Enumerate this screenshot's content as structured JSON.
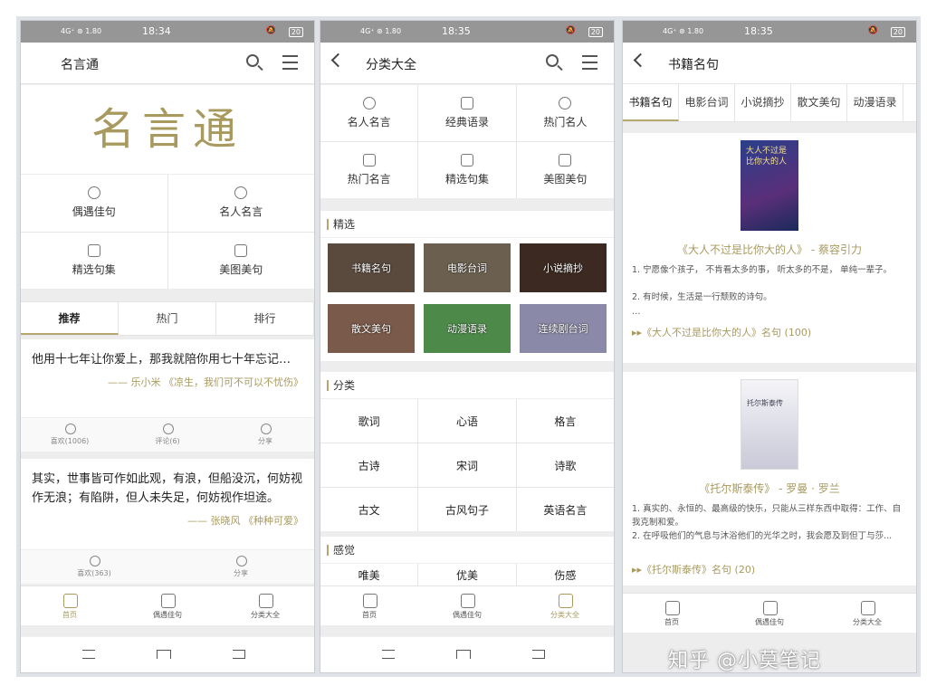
{
  "status": {
    "signal": "4G⁺ ⊛ 1.80",
    "battery": "20",
    "times": [
      "18:34",
      "18:35",
      "18:35"
    ]
  },
  "screen1": {
    "title": "名言通",
    "logo": "名言通",
    "menu": [
      "偶遇佳句",
      "名人名言",
      "精选句集",
      "美图美句"
    ],
    "tabs": [
      "推荐",
      "热门",
      "排行"
    ],
    "posts": [
      {
        "text": "他用十七年让你爱上，那我就陪你用七十年忘记…",
        "author": "—— 乐小米 《凉生，我们可不可以不忧伤》",
        "likes": "喜欢(1006)",
        "comments": "评论(6)",
        "share": "分享"
      },
      {
        "text": "其实，世事皆可作如此观，有浪，但船没沉，何妨视作无浪；有陷阱，但人未失足，何妨视作坦途。",
        "author": "—— 张晓风 《种种可爱》",
        "likes": "喜欢(363)",
        "share": "分享"
      }
    ],
    "nav": [
      "首页",
      "偶遇佳句",
      "分类大全"
    ]
  },
  "screen2": {
    "title": "分类大全",
    "grid": [
      "名人名言",
      "经典语录",
      "热门名人",
      "热门名言",
      "精选句集",
      "美图美句"
    ],
    "featured_label": "精选",
    "featured": [
      "书籍名句",
      "电影台词",
      "小说摘抄",
      "散文美句",
      "动漫语录",
      "连续剧台词"
    ],
    "category_label": "分类",
    "categories": [
      "歌词",
      "心语",
      "格言",
      "古诗",
      "宋词",
      "诗歌",
      "古文",
      "古风句子",
      "英语名言"
    ],
    "feeling_label": "感觉",
    "feelings": [
      "唯美",
      "优美",
      "伤感"
    ],
    "nav": [
      "首页",
      "偶遇佳句",
      "分类大全"
    ]
  },
  "screen3": {
    "title": "书籍名句",
    "tabs": [
      "书籍名句",
      "电影台词",
      "小说摘抄",
      "散文美句",
      "动漫语录"
    ],
    "books": [
      {
        "title": "《大人不过是比你大的人》",
        "author": "- 蔡容引力",
        "lines": [
          "1. 宁愿像个孩子， 不肯看太多的事， 听太多的不是， 单纯一辈子。",
          "2. 有时候，生活是一行颓败的诗句。",
          "…"
        ],
        "link": "▸▸《大人不过是比你大的人》名句 (100)",
        "cover_text": "大人不过是比你大的人"
      },
      {
        "title": "《托尔斯泰传》",
        "author": "- 罗曼 · 罗兰",
        "lines": [
          "1. 真实的、永恒的、最高级的快乐，只能从三样东西中取得：工作、自我克制和爱。",
          "2. 在呼吸他们的气息与沐浴他们的光华之时，我会愿及到但丁与莎..."
        ],
        "link": "▸▸《托尔斯泰传》名句 (20)",
        "cover_text": "托尔斯泰传"
      }
    ],
    "nav": [
      "首页",
      "偶遇佳句",
      "分类大全"
    ]
  },
  "watermark": "知乎 @小莫笔记",
  "colors": {
    "accent": "#a89a5f",
    "statusbar": "#969696",
    "divider": "#e5e5e5"
  }
}
